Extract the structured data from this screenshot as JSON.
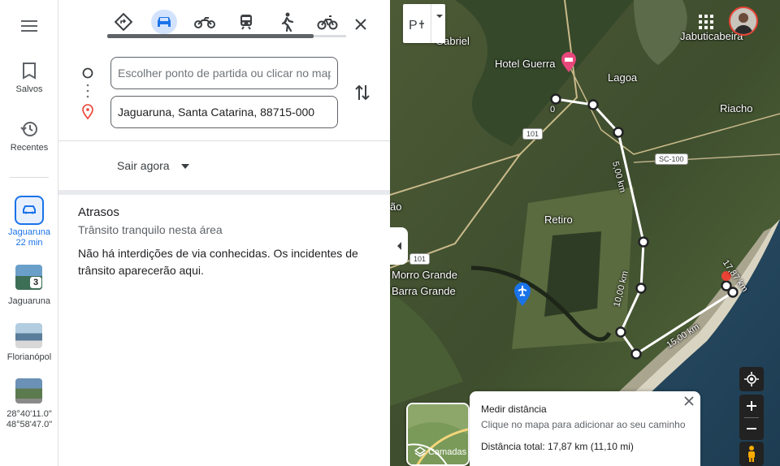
{
  "rail": {
    "saved_label": "Salvos",
    "recent_label": "Recentes",
    "recents": [
      {
        "name": "Jaguaruna",
        "detail": "22 min"
      },
      {
        "name": "Jaguaruna",
        "badge": "3"
      },
      {
        "name": "Florianópol"
      },
      {
        "line1": "28°40'11.0\"",
        "line2": "48°58'47.0\""
      }
    ]
  },
  "directions": {
    "origin_placeholder": "Escolher ponto de partida ou clicar no mapa",
    "destination_value": "Jaguaruna, Santa Catarina, 88715-000",
    "depart_label": "Sair agora",
    "delays_title": "Atrasos",
    "delays_subtitle": "Trânsito tranquilo nesta área",
    "delays_body": "Não há interdições de via conhecidas. Os incidentes de trânsito aparecerão aqui."
  },
  "map": {
    "labels": {
      "gabriel": "Gabriel",
      "hotel": "Hotel Guerra",
      "lagoa": "Lagoa",
      "riacho": "Riacho",
      "jabuticabeira": "Jabuticabeira",
      "retiro": "Retiro",
      "morro_grande": "Morro Grande",
      "barra_grande": "Barra Grande",
      "edge": "ão",
      "zero": "0",
      "seg1": "5,00 km",
      "seg2": "10,00 km",
      "seg3": "15,00 km",
      "seg4": "17,87 km"
    },
    "roads": {
      "r101a": "101",
      "r101b": "101",
      "sc100": "SC-100"
    },
    "layers_label": "Camadas",
    "measure": {
      "title": "Medir distância",
      "hint": "Clique no mapa para adicionar ao seu caminho",
      "total": "Distância total: 17,87 km (11,10 mi)"
    }
  }
}
